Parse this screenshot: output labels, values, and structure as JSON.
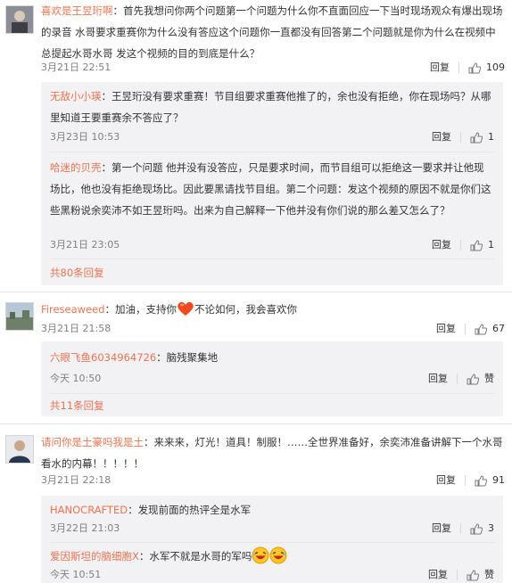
{
  "comments": [
    {
      "user": "喜欢是王昱珩啊",
      "text": "：首先我想问你两个问题第一个问题为什么你不直面回应一下当时现场观众有爆出现场的录音 水哥要求重赛你为什么没有答应这个问题你一直都没有回答第二个问题就是你为什么在视频中总提起水哥水哥 发这个视频的目的到底是什么？",
      "time": "3月21日 22:51",
      "reply_label": "回复",
      "likes": "109",
      "replies": [
        {
          "user": "无敌小小瑛",
          "text": "：王昱珩没有要求重赛！节目组要求重赛他推了的，余也没有拒绝，你在现场吗？从哪里知道王要重赛余不答应了？",
          "time": "3月23日 10:53",
          "reply_label": "回复",
          "likes": "1"
        },
        {
          "user": "哈迷的贝壳",
          "text": "：第一个问题 他并没有没答应，只是要求时间，而节目组可以拒绝这一要求并让他现场比，他也没有拒绝现场比。因此要黑请找节目组。第二个问题：发这个视频的原因不就是你们这些黑粉说余奕沛不如王昱珩吗。出来为自己解释一下他并没有你们说的那么差又怎么了？",
          "time": "3月21日 23:05",
          "reply_label": "回复",
          "likes": "1"
        }
      ],
      "more": "共80条回复"
    },
    {
      "user": "Fireseaweed",
      "text_before": "：加油，支持你",
      "text_after": "不论如何，我会喜欢你",
      "time": "3月21日 21:58",
      "reply_label": "回复",
      "likes": "67",
      "replies": [
        {
          "user": "六眼飞鱼6034964726",
          "text": "：脑残聚集地",
          "time": "今天 10:50",
          "reply_label": "回复",
          "likes": "赞"
        }
      ],
      "more": "共11条回复"
    },
    {
      "user": "请问你是土豪吗我是土",
      "text": "：来来来，灯光！道具！制服！……全世界准备好，余奕沛准备讲解下一个水哥看水的内幕！！！！！",
      "time": "3月21日 22:18",
      "reply_label": "回复",
      "likes": "91",
      "replies": [
        {
          "user": "HANOCRAFTED",
          "text": "：发现前面的热评全是水军",
          "time": "3月22日 21:03",
          "reply_label": "回复",
          "likes": "3"
        },
        {
          "user": "爱因斯坦的脑细胞X",
          "text": "：水军不就是水哥的军吗",
          "time": "今天 10:51",
          "reply_label": "回复",
          "likes": "赞"
        }
      ]
    }
  ],
  "icons": {
    "like": "thumb-up-icon",
    "heart": "heart-emoji",
    "laugh": "laughing-emoji"
  },
  "colors": {
    "username": "#eb7350",
    "reply_bg": "#f2f2f5",
    "meta": "#808080"
  }
}
